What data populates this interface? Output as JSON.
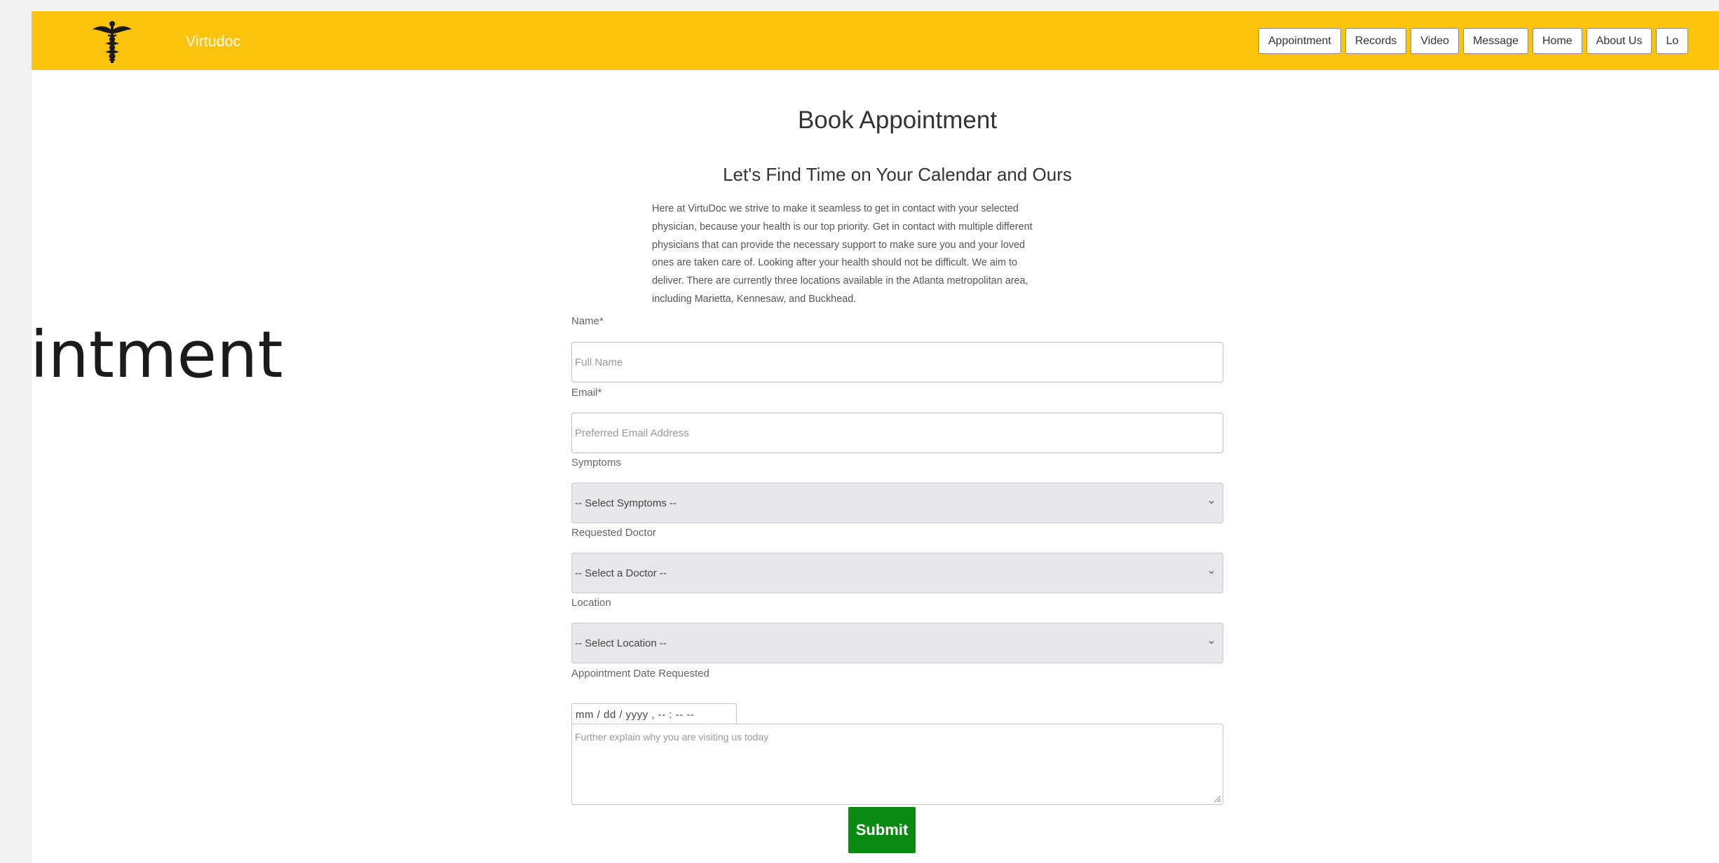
{
  "brand": {
    "name": "Virtudoc",
    "logo_icon": "caduceus-icon",
    "bar_color": "#fcc30b"
  },
  "nav": {
    "items": [
      {
        "label": "Appointment"
      },
      {
        "label": "Records"
      },
      {
        "label": "Video"
      },
      {
        "label": "Message"
      },
      {
        "label": "Home"
      },
      {
        "label": "About Us"
      },
      {
        "label": "Lo"
      }
    ]
  },
  "background_text": "intment",
  "main": {
    "title": "Book Appointment",
    "subtitle": "Let's Find Time on Your Calendar and Ours",
    "intro_lines": [
      "Here at VirtuDoc we strive to make it seamless to get in contact with your selected",
      "physician, because your health is our top priority. Get in contact with multiple different",
      "physicians that can provide the necessary support to make sure you and your loved",
      "ones are taken care of. Looking after your health should not be difficult. We aim to",
      "deliver. There are currently three locations available in the Atlanta metropolitan area,",
      "including Marietta, Kennesaw, and Buckhead."
    ]
  },
  "form": {
    "name": {
      "label": "Name*",
      "placeholder": "Full Name",
      "value": ""
    },
    "email": {
      "label": "Email*",
      "placeholder": "Preferred Email Address",
      "value": ""
    },
    "symptoms": {
      "label": "Symptoms",
      "selected": "-- Select Symptoms --"
    },
    "doctor": {
      "label": "Requested Doctor",
      "selected": "-- Select a Doctor --"
    },
    "location": {
      "label": "Location",
      "selected": "-- Select Location --"
    },
    "date": {
      "label": "Appointment Date Requested",
      "value": "mm / dd / yyyy , -- : -- --"
    },
    "reason": {
      "placeholder": "Further explain why you are visiting us today",
      "value": ""
    },
    "submit_label": "Submit",
    "submit_color": "#0a8a12"
  }
}
